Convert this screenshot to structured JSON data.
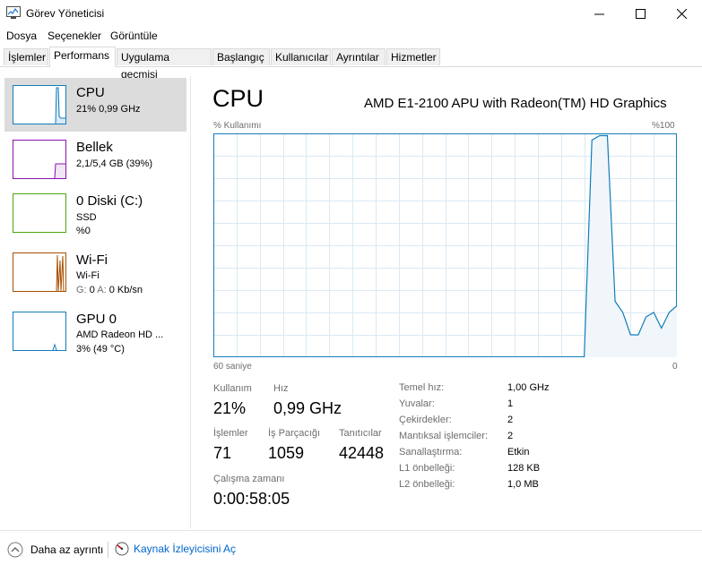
{
  "window": {
    "title": "Görev Yöneticisi",
    "controls": {
      "minimize": "—",
      "maximize": "☐",
      "close": "✕"
    }
  },
  "menu": [
    "Dosya",
    "Seçenekler",
    "Görüntüle"
  ],
  "tabs": [
    "İşlemler",
    "Performans",
    "Uygulama geçmişi",
    "Başlangıç",
    "Kullanıcılar",
    "Ayrıntılar",
    "Hizmetler"
  ],
  "active_tab": "Performans",
  "sidebar": {
    "items": [
      {
        "name": "CPU",
        "lines": [
          "21%  0,99 GHz"
        ],
        "color": "#117dbb"
      },
      {
        "name": "Bellek",
        "lines": [
          "2,1/5,4 GB (39%)"
        ],
        "color": "#8b12ae"
      },
      {
        "name": "0 Diski (C:)",
        "lines": [
          "SSD",
          "%0"
        ],
        "color": "#4da60c"
      },
      {
        "name": "Wi-Fi",
        "lines": [
          "Wi-Fi"
        ],
        "wifi_rates": {
          "g": "G:",
          "g_val": "0",
          "a": "A:",
          "a_val": "0 Kb/sn"
        },
        "color": "#a74f01"
      },
      {
        "name": "GPU 0",
        "lines": [
          "AMD Radeon HD ...",
          "3% (49 °C)"
        ],
        "color": "#117dbb"
      }
    ]
  },
  "main": {
    "title": "CPU",
    "model": "AMD E1-2100 APU with Radeon(TM) HD Graphics",
    "graph": {
      "y_label": "% Kullanımı",
      "y_max_label": "%100",
      "x_left_label": "60 saniye",
      "x_right_label": "0"
    },
    "stats": {
      "usage_label": "Kullanım",
      "usage": "21%",
      "speed_label": "Hız",
      "speed": "0,99 GHz",
      "processes_label": "İşlemler",
      "processes": "71",
      "threads_label": "İş Parçacığı",
      "threads": "1059",
      "handles_label": "Tanıtıcılar",
      "handles": "42448",
      "uptime_label": "Çalışma zamanı",
      "uptime": "0:00:58:05"
    },
    "specs": [
      {
        "label": "Temel hız:",
        "value": "1,00 GHz"
      },
      {
        "label": "Yuvalar:",
        "value": "1"
      },
      {
        "label": "Çekirdekler:",
        "value": "2"
      },
      {
        "label": "Mantıksal işlemciler:",
        "value": "2"
      },
      {
        "label": "Sanallaştırma:",
        "value": "Etkin"
      },
      {
        "label": "L1 önbelleği:",
        "value": "128 KB"
      },
      {
        "label": "L2 önbelleği:",
        "value": "1,0 MB"
      }
    ]
  },
  "footer": {
    "less_details": "Daha az ayrıntı",
    "resource_monitor": "Kaynak İzleyicisini Aç"
  },
  "chart_data": {
    "type": "area",
    "x_unit": "seconds ago",
    "x": [
      60,
      59,
      58,
      57,
      56,
      55,
      54,
      53,
      52,
      51,
      50,
      49,
      48,
      47,
      46,
      45,
      44,
      43,
      42,
      41,
      40,
      39,
      38,
      37,
      36,
      35,
      34,
      33,
      32,
      31,
      30,
      29,
      28,
      27,
      26,
      25,
      24,
      23,
      22,
      21,
      20,
      19,
      18,
      17,
      16,
      15,
      14,
      13,
      12,
      11,
      10,
      9,
      8,
      7,
      6,
      5,
      4,
      3,
      2,
      1,
      0
    ],
    "values": [
      null,
      null,
      null,
      null,
      null,
      null,
      null,
      null,
      null,
      null,
      null,
      null,
      null,
      null,
      null,
      null,
      null,
      null,
      null,
      null,
      null,
      null,
      null,
      null,
      null,
      null,
      null,
      null,
      null,
      null,
      null,
      null,
      null,
      null,
      null,
      null,
      null,
      null,
      null,
      null,
      null,
      null,
      null,
      null,
      null,
      null,
      null,
      null,
      0,
      97,
      99,
      99,
      25,
      20,
      10,
      10,
      18,
      20,
      13,
      20,
      23
    ],
    "ylim": [
      0,
      100
    ],
    "grid": true,
    "color": "#117dbb"
  }
}
